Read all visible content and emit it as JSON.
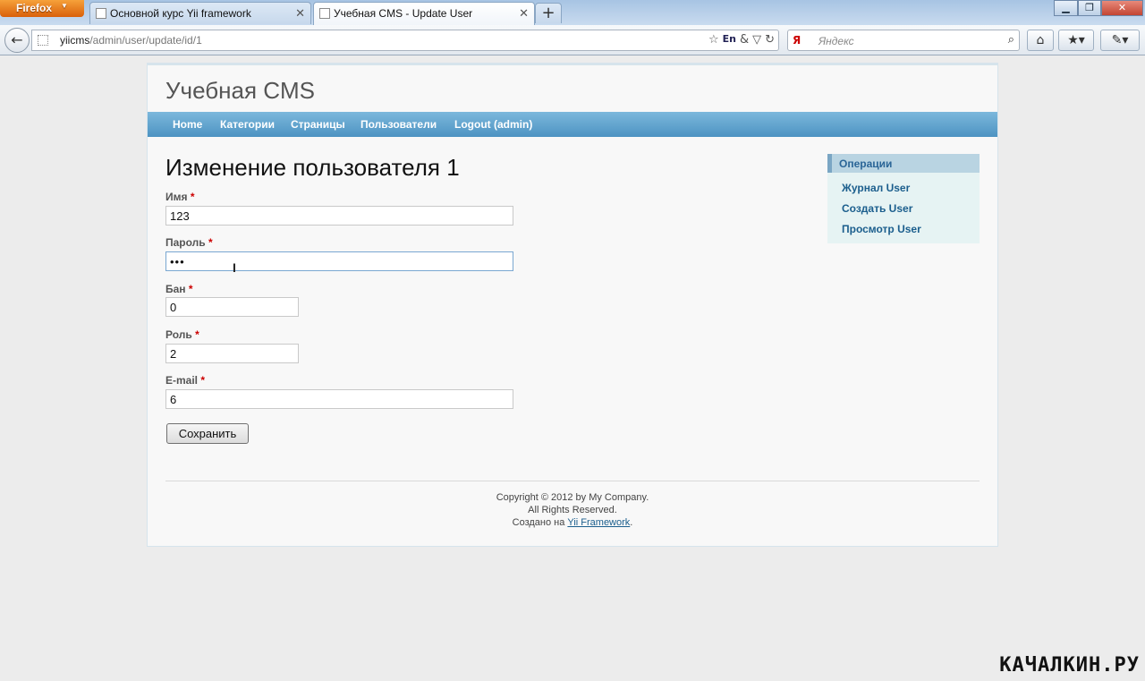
{
  "browser": {
    "menu_button": "Firefox",
    "tabs": [
      {
        "title": "Основной курс Yii framework"
      },
      {
        "title": "Учебная CMS - Update User"
      }
    ],
    "url_host": "yiicms",
    "url_path": "/admin/user/update/id/1",
    "search_placeholder": "Яндекс",
    "search_engine": "Я",
    "lang_indicator": "En"
  },
  "site": {
    "logo": "Учебная CMS",
    "menu": [
      {
        "label": "Home"
      },
      {
        "label": "Категории"
      },
      {
        "label": "Страницы"
      },
      {
        "label": "Пользователи"
      },
      {
        "label": "Logout (admin)"
      }
    ]
  },
  "form": {
    "title": "Изменение пользователя 1",
    "required_mark": "*",
    "fields": [
      {
        "label": "Имя",
        "value": "123"
      },
      {
        "label": "Пароль",
        "value": "•••"
      },
      {
        "label": "Бан",
        "value": "0"
      },
      {
        "label": "Роль",
        "value": "2"
      },
      {
        "label": "E-mail",
        "value": "6"
      }
    ],
    "submit_label": "Сохранить"
  },
  "sidebar": {
    "title": "Операции",
    "links": [
      {
        "label": "Журнал User"
      },
      {
        "label": "Создать User"
      },
      {
        "label": "Просмотр User"
      }
    ]
  },
  "footer": {
    "line1": "Copyright © 2012 by My Company.",
    "line2": "All Rights Reserved.",
    "line3_prefix": "Создано на ",
    "line3_link": "Yii Framework",
    "line3_suffix": "."
  },
  "watermark": "КАЧАЛКИН.РУ"
}
